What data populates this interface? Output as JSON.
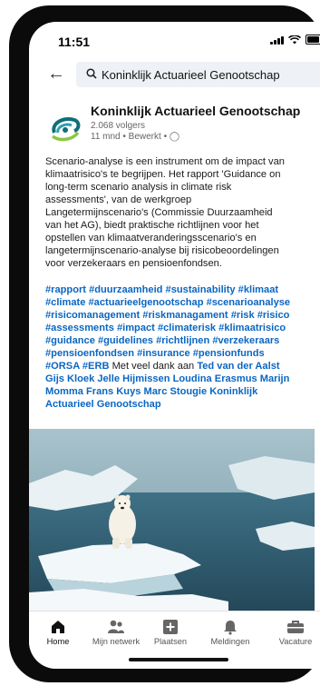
{
  "status": {
    "time": "11:51"
  },
  "search": {
    "query": "Koninklijk Actuarieel Genootschap"
  },
  "post": {
    "org_name": "Koninklijk Actuarieel Genootschap",
    "followers": "2.068 volgers",
    "meta": "11 mnd • Bewerkt • ",
    "body_lines": [
      "Scenario-analyse is een instrument om de impact van",
      "klimaatrisico's te begrijpen. Het rapport 'Guidance on",
      "long-term scenario analysis in climate risk",
      "assessments', van de werkgroep",
      "Langetermijnscenario's (Commissie Duurzaamheid",
      "van het AG), biedt praktische richtlijnen voor het",
      "opstellen van klimaatveranderingsscenario's en",
      "langetermijnscenario-analyse bij risicobeoordelingen",
      "voor verzekeraars en pensioenfondsen."
    ],
    "hashtag_lines": [
      "#rapport #duurzaamheid #sustainability #klimaat",
      "#climate #actuarieelgenootschap #scenarioanalyse",
      "#risicomanagement #riskmanagament #risk #risico",
      "#assessments #impact #climaterisk #klimaatrisico",
      "#guidance #guidelines #richtlijnen #verzekeraars",
      "#pensioenfondsen #insurance #pensionfunds"
    ],
    "last_line_tags": "#ORSA #ERB",
    "thanks_text": " Met veel dank aan ",
    "mention_lines": [
      "Ted van der Aalst",
      "Gijs Kloek Jelle Hijmissen Loudina Erasmus Marijn",
      "Momma Frans Kuys Marc Stougie Koninklijk",
      "Actuarieel Genootschap"
    ]
  },
  "nav": [
    {
      "label": "Home",
      "icon": "home-icon"
    },
    {
      "label": "Mijn netwerk",
      "icon": "network-icon"
    },
    {
      "label": "Plaatsen",
      "icon": "plus-box-icon"
    },
    {
      "label": "Meldingen",
      "icon": "bell-icon"
    },
    {
      "label": "Vacature",
      "icon": "briefcase-icon"
    }
  ],
  "colors": {
    "link": "#0a66c2",
    "accent_strip": "#7bc143"
  }
}
